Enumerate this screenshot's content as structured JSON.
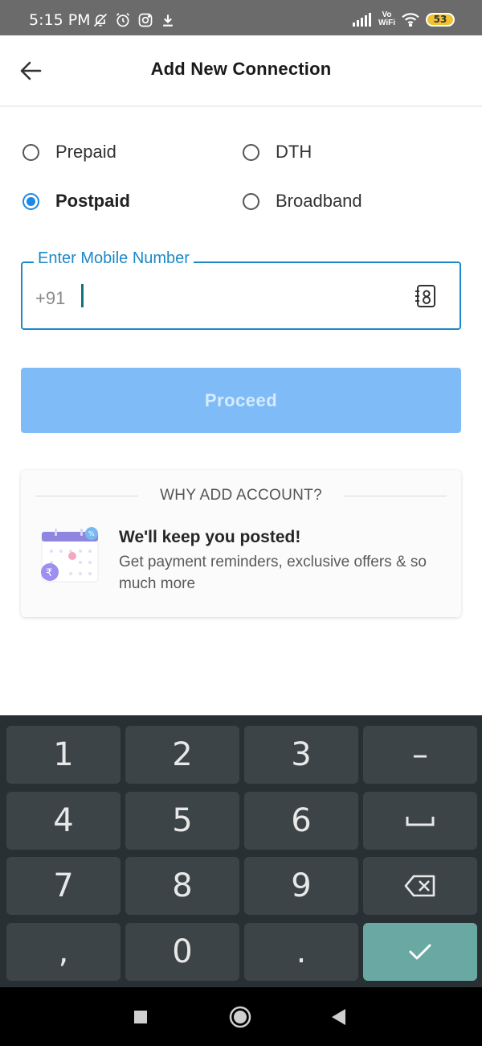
{
  "status_bar": {
    "time": "5:15 PM",
    "vowifi_top": "Vo",
    "vowifi_bottom": "WiFi",
    "battery": "53"
  },
  "header": {
    "title": "Add New Connection"
  },
  "connection_types": [
    {
      "label": "Prepaid",
      "checked": false
    },
    {
      "label": "DTH",
      "checked": false
    },
    {
      "label": "Postpaid",
      "checked": true
    },
    {
      "label": "Broadband",
      "checked": false
    }
  ],
  "mobile_field": {
    "label": "Enter Mobile Number",
    "prefix": "+91",
    "value": ""
  },
  "proceed_label": "Proceed",
  "info_card": {
    "heading": "WHY ADD ACCOUNT?",
    "title": "We'll keep you posted!",
    "description": "Get payment reminders, exclusive offers & so much more"
  },
  "keyboard": {
    "keys": [
      "1",
      "2",
      "3",
      "–",
      "4",
      "5",
      "6",
      "space",
      "7",
      "8",
      "9",
      "backspace",
      ",",
      "0",
      ".",
      "done"
    ]
  },
  "colors": {
    "accent": "#1e88e5",
    "field_border": "#1d88c9",
    "proceed_disabled": "#7fbcf7",
    "keyboard_bg": "#293033",
    "key_bg": "#3c4447",
    "done_key": "#6aa8a3"
  }
}
